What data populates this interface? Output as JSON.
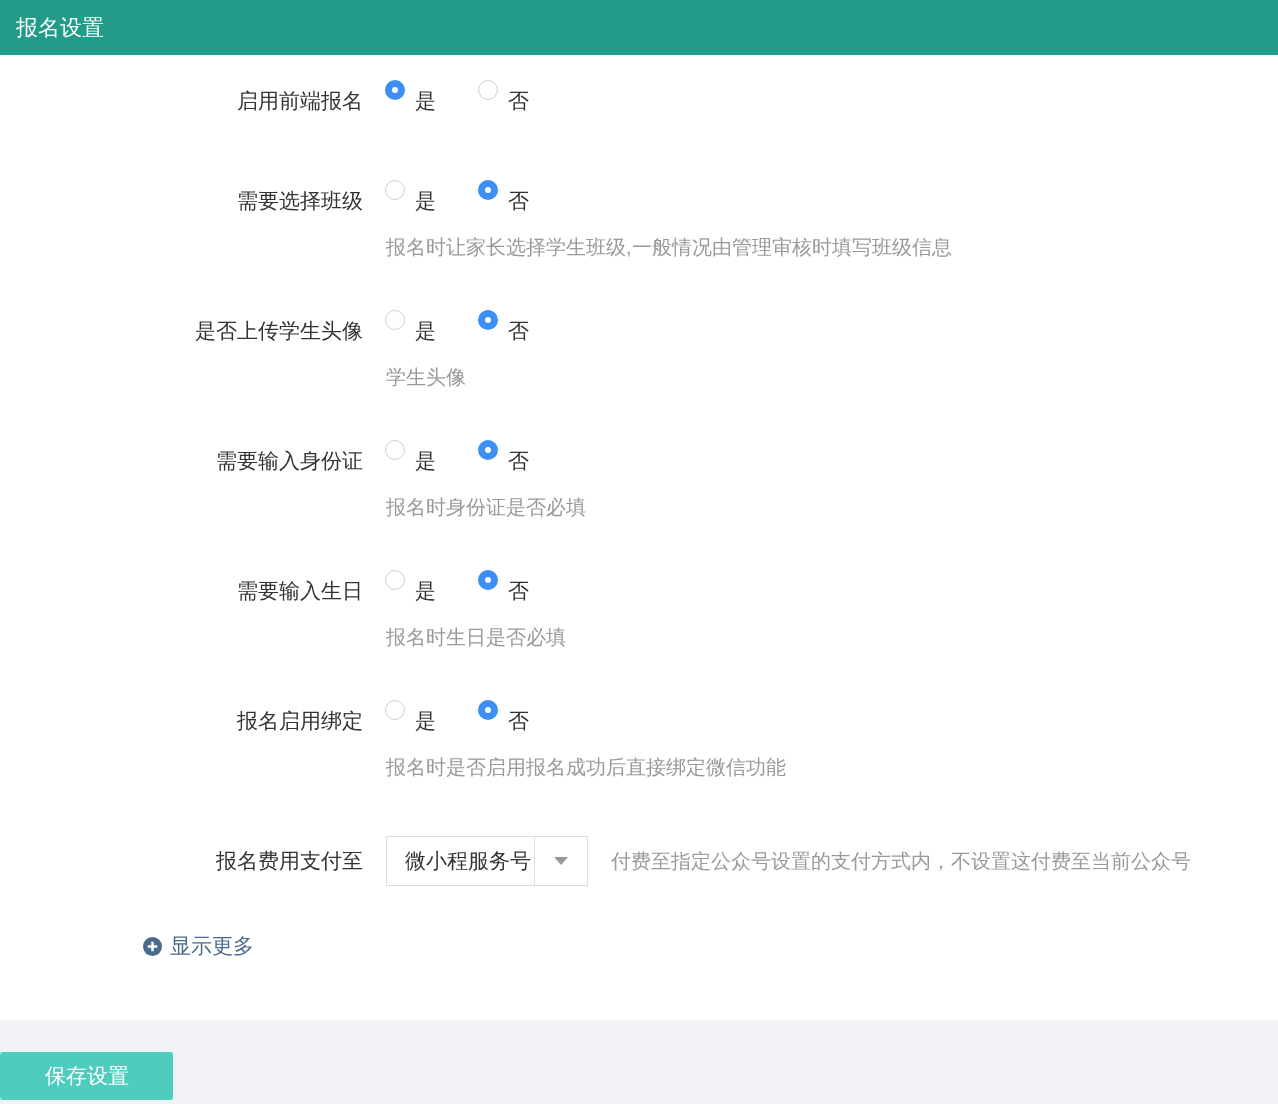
{
  "header": {
    "title": "报名设置"
  },
  "settings": [
    {
      "kind": "radio",
      "label": "启用前端报名",
      "options": [
        {
          "label": "是",
          "selected": true
        },
        {
          "label": "否",
          "selected": false
        }
      ]
    },
    {
      "kind": "radio",
      "label": "需要选择班级",
      "options": [
        {
          "label": "是",
          "selected": false
        },
        {
          "label": "否",
          "selected": true
        }
      ],
      "hint": "报名时让家长选择学生班级,一般情况由管理审核时填写班级信息"
    },
    {
      "kind": "radio",
      "label": "是否上传学生头像",
      "options": [
        {
          "label": "是",
          "selected": false
        },
        {
          "label": "否",
          "selected": true
        }
      ],
      "hint": "学生头像"
    },
    {
      "kind": "radio",
      "label": "需要输入身份证",
      "options": [
        {
          "label": "是",
          "selected": false
        },
        {
          "label": "否",
          "selected": true
        }
      ],
      "hint": "报名时身份证是否必填"
    },
    {
      "kind": "radio",
      "label": "需要输入生日",
      "options": [
        {
          "label": "是",
          "selected": false
        },
        {
          "label": "否",
          "selected": true
        }
      ],
      "hint": "报名时生日是否必填"
    },
    {
      "kind": "radio",
      "label": "报名启用绑定",
      "options": [
        {
          "label": "是",
          "selected": false
        },
        {
          "label": "否",
          "selected": true
        }
      ],
      "hint": "报名时是否启用报名成功后直接绑定微信功能"
    },
    {
      "kind": "select",
      "label": "报名费用支付至",
      "value": "微小程服务号",
      "hint": "付费至指定公众号设置的支付方式内，不设置这付费至当前公众号"
    }
  ],
  "show_more": {
    "label": "显示更多"
  },
  "save_button": {
    "label": "保存设置"
  }
}
